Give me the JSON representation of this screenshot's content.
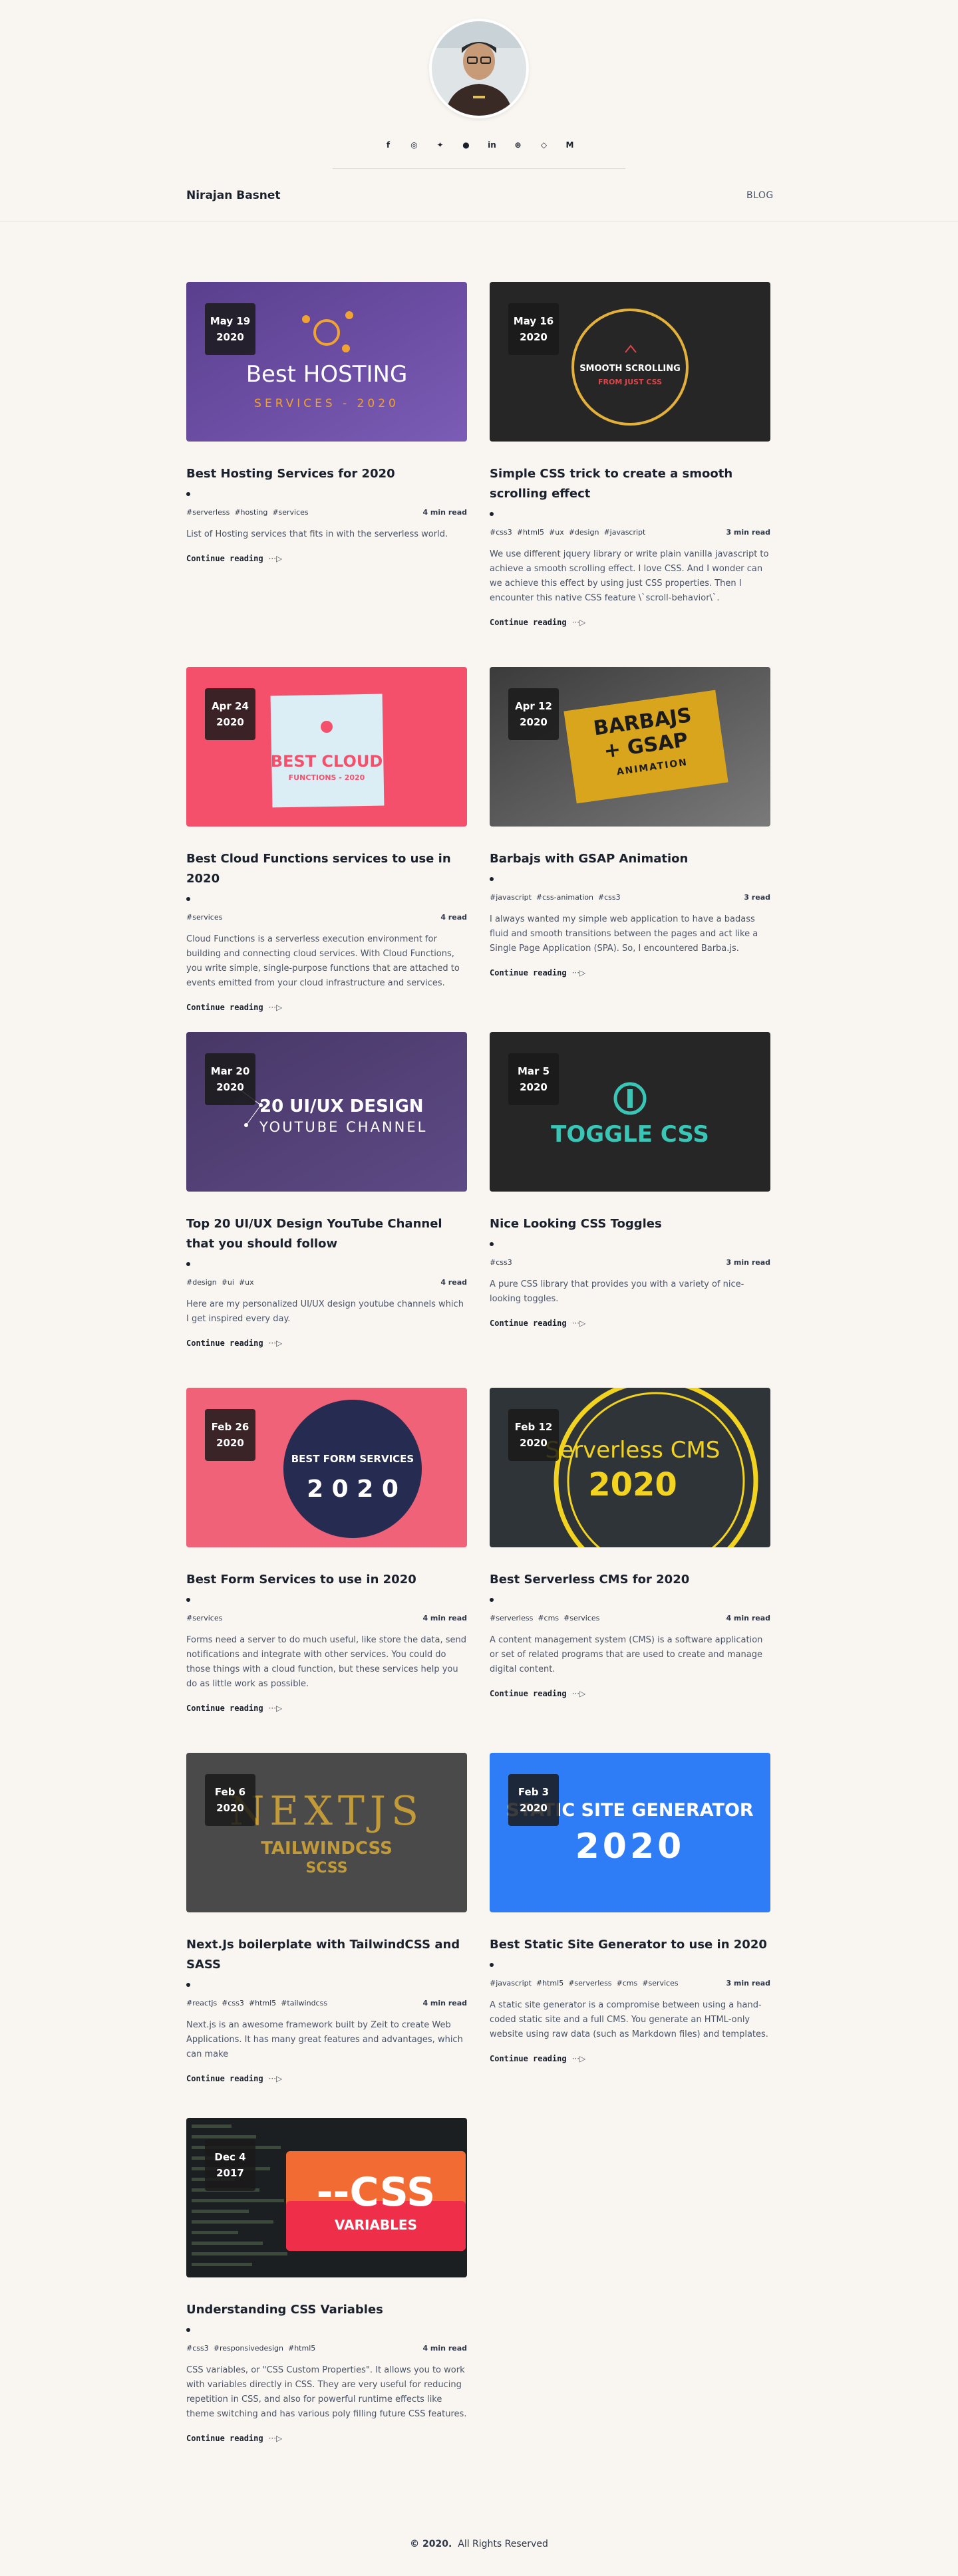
{
  "header": {
    "name": "Nirajan Basnet",
    "nav_blog": "BLOG",
    "social_icons": [
      {
        "name": "facebook-icon",
        "glyph": "f"
      },
      {
        "name": "instagram-icon",
        "glyph": "◎"
      },
      {
        "name": "twitter-icon",
        "glyph": "✦"
      },
      {
        "name": "github-icon",
        "glyph": "●"
      },
      {
        "name": "linkedin-icon",
        "glyph": "in"
      },
      {
        "name": "dribbble-icon",
        "glyph": "⊕"
      },
      {
        "name": "codepen-icon",
        "glyph": "◇"
      },
      {
        "name": "medium-icon",
        "glyph": "M"
      }
    ]
  },
  "posts": [
    {
      "day": "May 19",
      "year": "2020",
      "title": "Best Hosting Services for 2020",
      "tags": [
        "#serverless",
        "#hosting",
        "#services"
      ],
      "read": "4 min read",
      "excerpt": "List of Hosting services that fits in with the serverless world.",
      "more": "Continue reading",
      "thumb_lines": [
        "Best HOSTING",
        "SERVICES - 2020"
      ]
    },
    {
      "day": "May 16",
      "year": "2020",
      "title": "Simple CSS trick to create a smooth scrolling effect",
      "tags": [
        "#css3",
        "#html5",
        "#ux",
        "#design",
        "#javascript"
      ],
      "read": "3 min read",
      "excerpt": "We use different jquery library or write plain vanilla javascript to achieve a smooth scrolling effect. I love CSS. And I wonder can we achieve this effect by using just CSS properties. Then I encounter this native CSS feature \\`scroll-behavior\\`.",
      "more": "Continue reading",
      "thumb_lines": [
        "SMOOTH SCROLLING",
        "FROM JUST CSS"
      ]
    },
    {
      "day": "Apr 24",
      "year": "2020",
      "title": "Best Cloud Functions services to use in 2020",
      "tags": [
        "#services"
      ],
      "read": "4 read",
      "excerpt": "Cloud Functions is a serverless execution environment for building and connecting cloud services. With Cloud Functions, you write simple, single-purpose functions that are attached to events emitted from your cloud infrastructure and services.",
      "more": "Continue reading",
      "thumb_lines": [
        "BEST CLOUD",
        "FUNCTIONS - 2020"
      ]
    },
    {
      "day": "Apr 12",
      "year": "2020",
      "title": "Barbajs with GSAP Animation",
      "tags": [
        "#javascript",
        "#css-animation",
        "#css3"
      ],
      "read": "3 read",
      "excerpt": "I always wanted my simple web application to have a badass fluid and smooth transitions between the pages and act like a Single Page Application (SPA). So, I encountered Barba.js.",
      "more": "Continue reading",
      "thumb_lines": [
        "BARBAJS",
        "+ GSAP",
        "ANIMATION"
      ]
    },
    {
      "day": "Mar 20",
      "year": "2020",
      "title": "Top 20 UI/UX Design YouTube Channel that you should follow",
      "tags": [
        "#design",
        "#ui",
        "#ux"
      ],
      "read": "4 read",
      "excerpt": "Here are my personalized UI/UX design youtube channels which I get inspired every day.",
      "more": "Continue reading",
      "thumb_lines": [
        "20 UI/UX DESIGN",
        "YOUTUBE CHANNEL"
      ]
    },
    {
      "day": "Mar 5",
      "year": "2020",
      "title": "Nice Looking CSS Toggles",
      "tags": [
        "#css3"
      ],
      "read": "3 min read",
      "excerpt": "A pure CSS library that provides you with a variety of nice-looking toggles.",
      "more": "Continue reading",
      "thumb_lines": [
        "TOGGLE CSS"
      ]
    },
    {
      "day": "Feb 26",
      "year": "2020",
      "title": "Best Form Services to use in 2020",
      "tags": [
        "#services"
      ],
      "read": "4 min read",
      "excerpt": "Forms need a server to do much useful, like store the data, send notifications and integrate with other services. You could do those things with a cloud function, but these services help you do as little work as possible.",
      "more": "Continue reading",
      "thumb_lines": [
        "BEST FORM SERVICES",
        "2 0 2 0"
      ]
    },
    {
      "day": "Feb 12",
      "year": "2020",
      "title": "Best Serverless CMS for 2020",
      "tags": [
        "#serverless",
        "#cms",
        "#services"
      ],
      "read": "4 min read",
      "excerpt": "A content management system (CMS) is a software application or set of related programs that are used to create and manage digital content.",
      "more": "Continue reading",
      "thumb_lines": [
        "Serverless CMS",
        "2020"
      ]
    },
    {
      "day": "Feb 6",
      "year": "2020",
      "title": "Next.Js boilerplate with TailwindCSS and SASS",
      "tags": [
        "#reactjs",
        "#css3",
        "#html5",
        "#tailwindcss"
      ],
      "read": "4 min read",
      "excerpt": "Next.js is an awesome framework built by Zeit to create Web Applications. It has many great features and advantages, which can make",
      "more": "Continue reading",
      "thumb_lines": [
        "NEXTJS",
        "TAILWINDCSS",
        "SCSS"
      ]
    },
    {
      "day": "Feb 3",
      "year": "2020",
      "title": "Best Static Site Generator to use in 2020",
      "tags": [
        "#javascript",
        "#html5",
        "#serverless",
        "#cms",
        "#services"
      ],
      "read": "3 min read",
      "excerpt": "A static site generator is a compromise between using a hand-coded static site and a full CMS. You generate an HTML-only website using raw data (such as Markdown files) and templates.",
      "more": "Continue reading",
      "thumb_lines": [
        "STATIC SITE GENERATOR",
        "2020"
      ]
    },
    {
      "day": "Dec 4",
      "year": "2017",
      "title": "Understanding CSS Variables",
      "tags": [
        "#css3",
        "#responsivedesign",
        "#html5"
      ],
      "read": "4 min read",
      "excerpt": "CSS variables, or \"CSS Custom Properties\". It allows you to work with variables directly in CSS. They are very useful for reducing repetition in CSS, and also for powerful runtime effects like theme switching and has various poly filling future CSS features.",
      "more": "Continue reading",
      "thumb_lines": [
        "--CSS",
        "VARIABLES"
      ]
    }
  ],
  "footer": {
    "year": "© 2020.",
    "rights": "All Rights Reserved"
  }
}
